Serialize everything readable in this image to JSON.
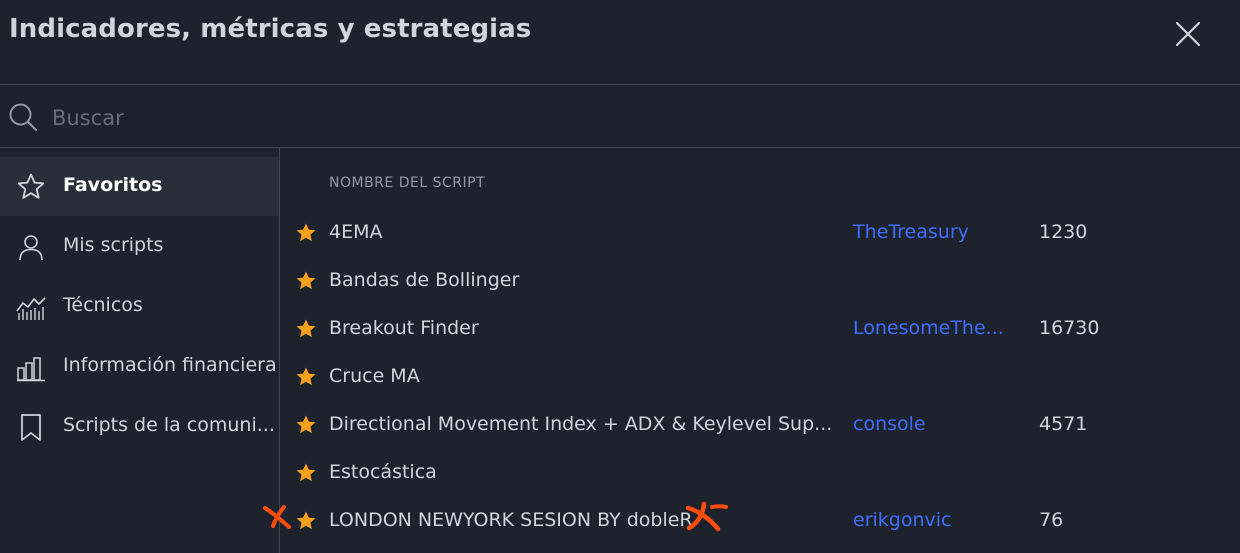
{
  "dialog": {
    "title": "Indicadores, métricas y estrategias",
    "close_icon": "close-icon"
  },
  "search": {
    "placeholder": "Buscar",
    "value": ""
  },
  "sidebar": {
    "items": [
      {
        "label": "Favoritos",
        "icon": "star-outline-icon",
        "active": true
      },
      {
        "label": "Mis scripts",
        "icon": "user-icon",
        "active": false
      },
      {
        "label": "Técnicos",
        "icon": "chart-line-icon",
        "active": false
      },
      {
        "label": "Información financiera",
        "icon": "bar-chart-icon",
        "active": false
      },
      {
        "label": "Scripts de la comuni...",
        "icon": "bookmark-icon",
        "active": false
      }
    ]
  },
  "table": {
    "column_header": "NOMBRE DEL SCRIPT",
    "rows": [
      {
        "name": "4EMA",
        "author": "TheTreasury",
        "count": "1230"
      },
      {
        "name": "Bandas de Bollinger",
        "author": "",
        "count": ""
      },
      {
        "name": "Breakout Finder",
        "author": "LonesomeThe...",
        "count": "16730"
      },
      {
        "name": "Cruce MA",
        "author": "",
        "count": ""
      },
      {
        "name": "Directional Movement Index + ADX & Keylevel Sup...",
        "author": "console",
        "count": "4571"
      },
      {
        "name": "Estocástica",
        "author": "",
        "count": ""
      },
      {
        "name": "LONDON NEWYORK SESION BY dobleR",
        "author": "erikgonvic",
        "count": "76"
      }
    ]
  },
  "colors": {
    "background": "#1e222d",
    "star": "#f7a21b",
    "author_link": "#3d6eff",
    "annotation_mark": "#ff4d0d"
  }
}
